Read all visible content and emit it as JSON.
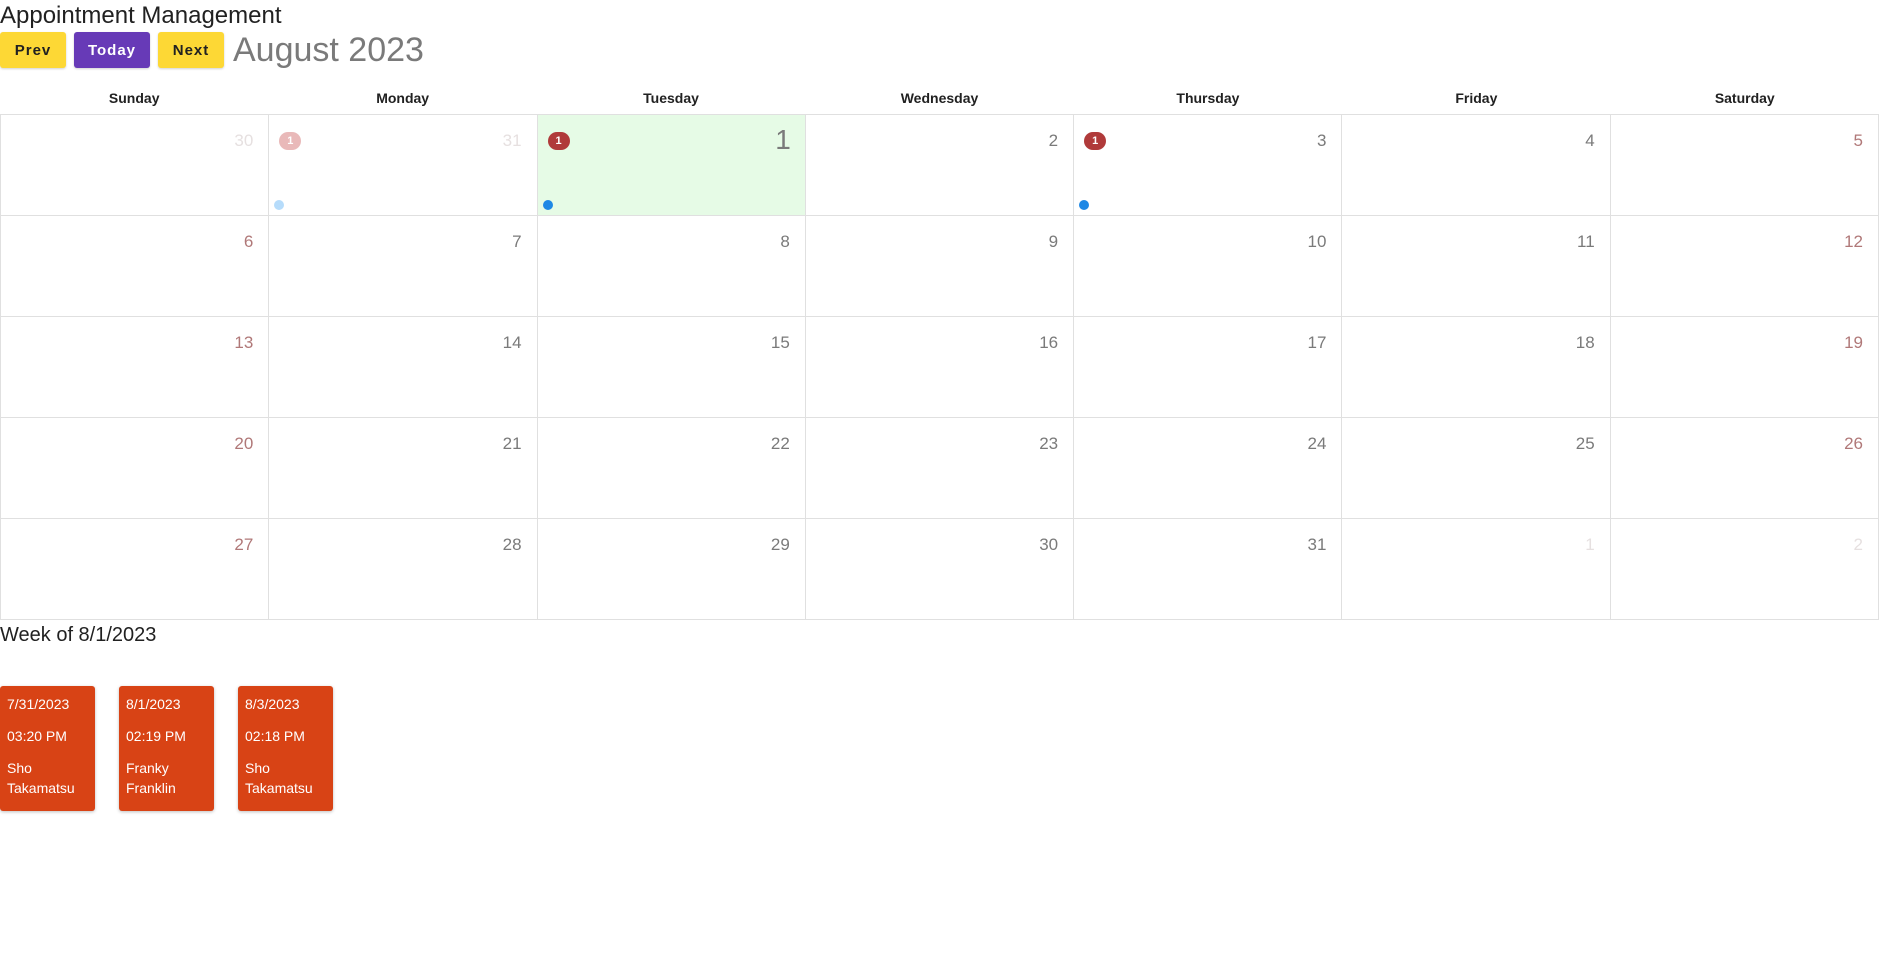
{
  "app": {
    "title": "Appointment Management"
  },
  "toolbar": {
    "prev_label": "Prev",
    "today_label": "Today",
    "next_label": "Next"
  },
  "calendar": {
    "month_title": "August 2023",
    "weekdays": [
      "Sunday",
      "Monday",
      "Tuesday",
      "Wednesday",
      "Thursday",
      "Friday",
      "Saturday"
    ],
    "weeks": [
      [
        {
          "day": "30",
          "outside": true
        },
        {
          "day": "31",
          "outside": true,
          "badge": "1"
        },
        {
          "day": "1",
          "today": true,
          "badge": "1"
        },
        {
          "day": "2"
        },
        {
          "day": "3",
          "badge": "1"
        },
        {
          "day": "4"
        },
        {
          "day": "5"
        }
      ],
      [
        {
          "day": "6"
        },
        {
          "day": "7"
        },
        {
          "day": "8"
        },
        {
          "day": "9"
        },
        {
          "day": "10"
        },
        {
          "day": "11"
        },
        {
          "day": "12"
        }
      ],
      [
        {
          "day": "13"
        },
        {
          "day": "14"
        },
        {
          "day": "15"
        },
        {
          "day": "16"
        },
        {
          "day": "17"
        },
        {
          "day": "18"
        },
        {
          "day": "19"
        }
      ],
      [
        {
          "day": "20"
        },
        {
          "day": "21"
        },
        {
          "day": "22"
        },
        {
          "day": "23"
        },
        {
          "day": "24"
        },
        {
          "day": "25"
        },
        {
          "day": "26"
        }
      ],
      [
        {
          "day": "27"
        },
        {
          "day": "28"
        },
        {
          "day": "29"
        },
        {
          "day": "30"
        },
        {
          "day": "31"
        },
        {
          "day": "1",
          "outside": true
        },
        {
          "day": "2",
          "outside": true
        }
      ]
    ]
  },
  "week": {
    "title": "Week of 8/1/2023",
    "appointments": [
      {
        "date": "7/31/2023",
        "time": "03:20 PM",
        "name": "Sho Takamatsu"
      },
      {
        "date": "8/1/2023",
        "time": "02:19 PM",
        "name": "Franky Franklin"
      },
      {
        "date": "8/3/2023",
        "time": "02:18 PM",
        "name": "Sho Takamatsu"
      }
    ]
  },
  "colors": {
    "prev_next_button": "#fdd835",
    "today_button": "#673ab7",
    "today_cell": "#e6fbe6",
    "badge": "#b03a3a",
    "event_dot": "#1e88e5",
    "appointment_card": "#d84315"
  }
}
